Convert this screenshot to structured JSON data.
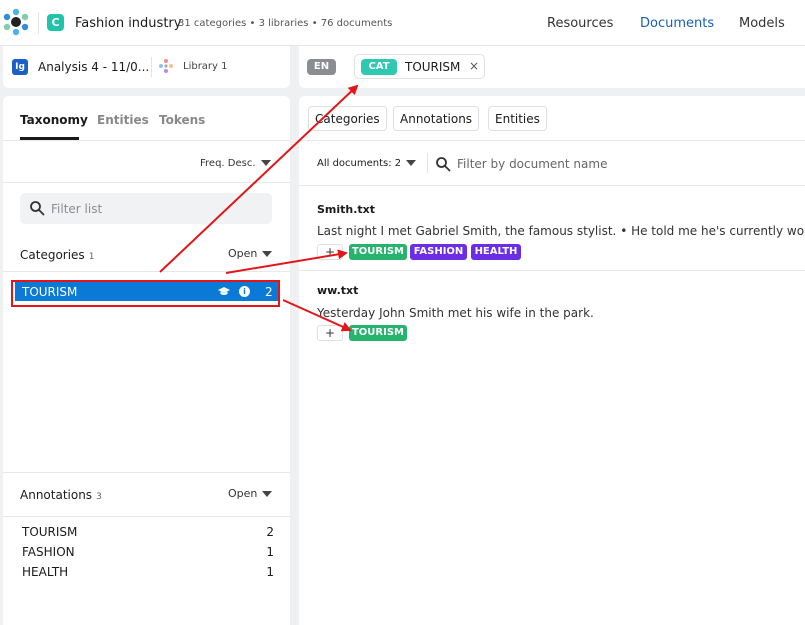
{
  "header": {
    "project_initial": "C",
    "project_name": "Fashion industry",
    "project_meta": "31 categories • 3 libraries • 76 documents",
    "nav": [
      "Resources",
      "Documents",
      "Models"
    ]
  },
  "analysis": {
    "badge": "Ig",
    "title": "Analysis 4 - 11/0...",
    "library": "Library 1"
  },
  "filter": {
    "lang": "EN",
    "tag": "CAT",
    "value": "TOURISM",
    "close": "×"
  },
  "left_tabs": [
    "Taxonomy",
    "Entities",
    "Tokens"
  ],
  "sort_label": "Freq. Desc.",
  "filter_list_placeholder": "Filter list",
  "categories": {
    "title": "Categories",
    "count": "1",
    "open_label": "Open",
    "items": [
      {
        "label": "TOURISM",
        "count": "2"
      }
    ]
  },
  "annotations": {
    "title": "Annotations",
    "count": "3",
    "open_label": "Open",
    "items": [
      {
        "label": "TOURISM",
        "count": "2"
      },
      {
        "label": "FASHION",
        "count": "1"
      },
      {
        "label": "HEALTH",
        "count": "1"
      }
    ]
  },
  "view_buttons": [
    "Categories",
    "Annotations",
    "Entities"
  ],
  "docs_filter": {
    "all_docs": "All documents: 2",
    "placeholder": "Filter by document name"
  },
  "documents": [
    {
      "title": "Smith.txt",
      "text": "Last night I met Gabriel Smith, the famous stylist.  •  He told me he's currently working",
      "add": "+",
      "tags": [
        "TOURISM",
        "FASHION",
        "HEALTH"
      ]
    },
    {
      "title": "ww.txt",
      "text": "Yesterday John Smith met his wife in the park.",
      "add": "+",
      "tags": [
        "TOURISM"
      ]
    }
  ],
  "colors": {
    "accent_blue": "#0a7ad6",
    "tag_green": "#25b36e",
    "tag_purple": "#6b2ee6",
    "cat_teal": "#2ec9b0",
    "annotation_red": "#e2161a"
  }
}
